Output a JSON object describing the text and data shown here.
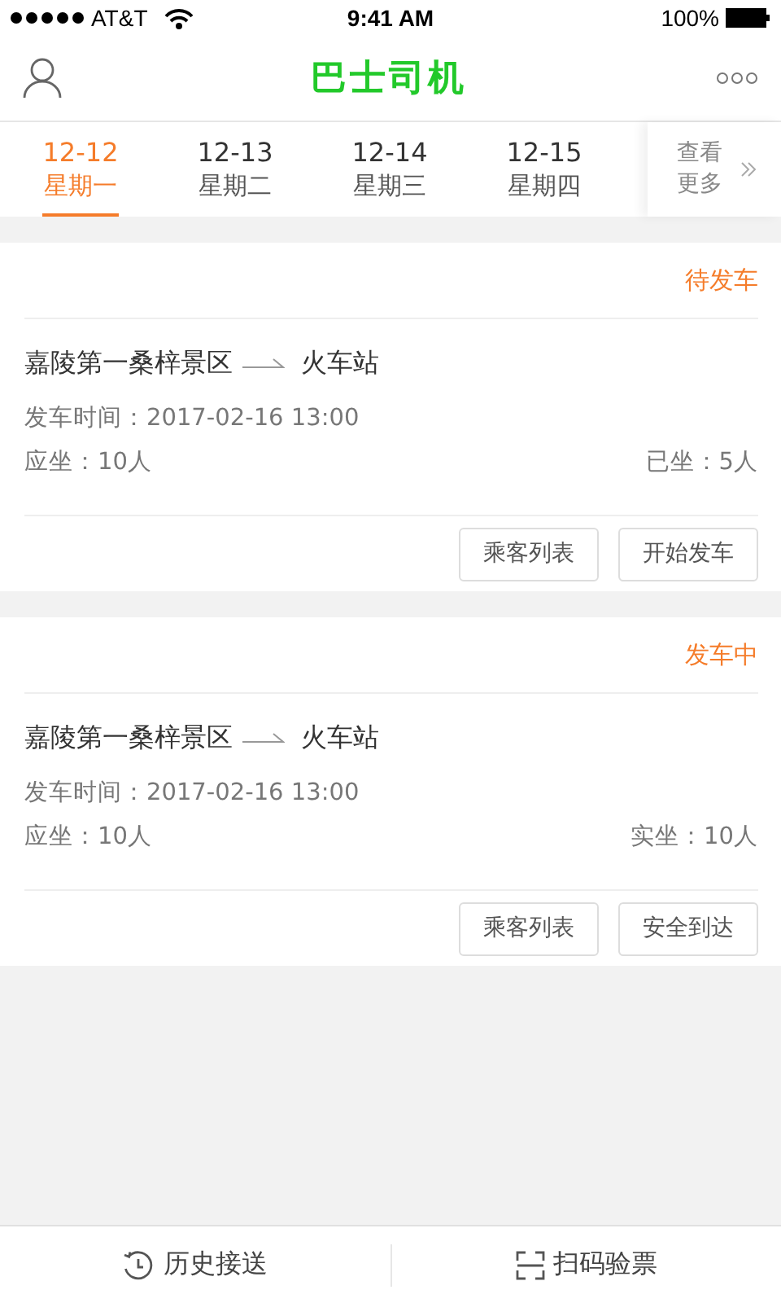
{
  "status_bar": {
    "carrier": "AT&T",
    "time": "9:41 AM",
    "battery": "100%"
  },
  "nav": {
    "title": "巴士司机"
  },
  "date_tabs": [
    {
      "date": "12-12",
      "weekday": "星期一",
      "selected": true
    },
    {
      "date": "12-13",
      "weekday": "星期二",
      "selected": false
    },
    {
      "date": "12-14",
      "weekday": "星期三",
      "selected": false
    },
    {
      "date": "12-15",
      "weekday": "星期四",
      "selected": false
    }
  ],
  "more": {
    "label": "查看更多"
  },
  "trips": [
    {
      "status": "待发车",
      "from": "嘉陵第一桑梓景区",
      "to": "火车站",
      "depart": "发车时间：2017-02-16 13:00",
      "seats_due": "应坐：10人",
      "seats_taken": "已坐：5人",
      "buttons": [
        "乘客列表",
        "开始发车"
      ]
    },
    {
      "status": "发车中",
      "from": "嘉陵第一桑梓景区",
      "to": "火车站",
      "depart": "发车时间：2017-02-16 13:00",
      "seats_due": "应坐：10人",
      "seats_taken": "实坐：10人",
      "buttons": [
        "乘客列表",
        "安全到达"
      ]
    }
  ],
  "bottom_bar": [
    {
      "kind": "history",
      "label": "历史接送"
    },
    {
      "kind": "scan",
      "label": "扫码验票"
    }
  ]
}
